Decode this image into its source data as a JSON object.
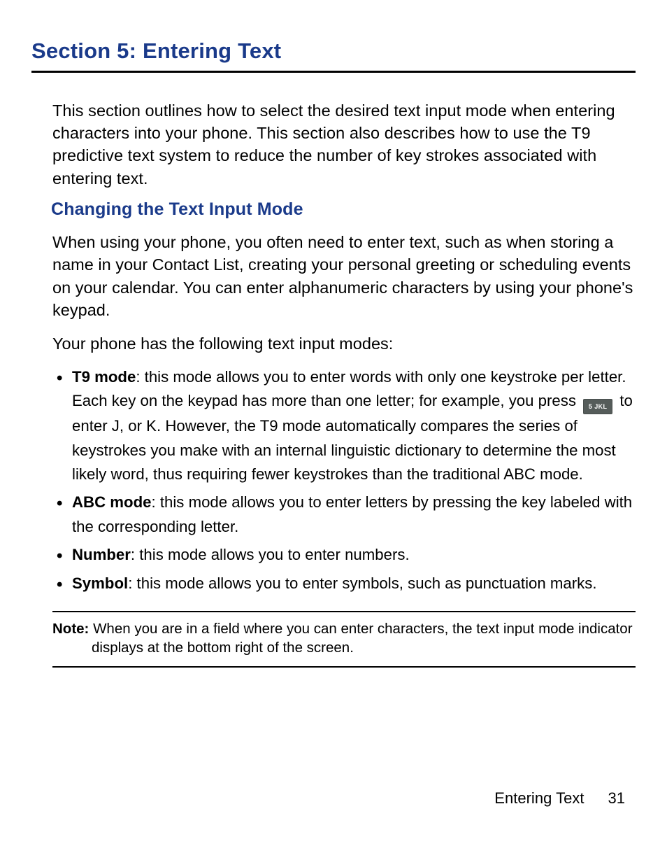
{
  "section_title": "Section 5: Entering Text",
  "intro": "This section outlines how to select the desired text input mode when entering characters into your phone. This section also describes how to use the T9 predictive text system to reduce the number of key strokes associated with entering text.",
  "sub_heading": "Changing the Text Input Mode",
  "body_p1": "When using your phone, you often need to enter text, such as when storing a name in your Contact List, creating your personal greeting or scheduling events on your calendar. You can enter alphanumeric characters by using your phone's keypad.",
  "body_p2": "Your phone has the following text input modes:",
  "modes": {
    "t9": {
      "bold": "T9 mode",
      "pre": ": this mode allows you to enter words with only one keystroke per letter. Each key on the keypad has more than one letter; for example, you press ",
      "key_label": "5 JKL",
      "post": " to enter J, or K. However, the T9 mode automatically compares the series of keystrokes you make with an internal linguistic dictionary to determine the most likely word, thus requiring fewer keystrokes than the traditional ABC mode."
    },
    "abc": {
      "bold": "ABC mode",
      "rest": ": this mode allows you to enter letters by pressing the key labeled with the corresponding letter."
    },
    "number": {
      "bold": "Number",
      "rest": ": this mode allows you to enter numbers."
    },
    "symbol": {
      "bold": "Symbol",
      "rest": ": this mode allows you to enter symbols, such as punctuation marks."
    }
  },
  "note": {
    "label": "Note:",
    "text": " When you are in a field where you can enter characters, the text input mode indicator displays at the bottom right of the screen."
  },
  "footer": {
    "section_name": "Entering Text",
    "page_number": "31"
  }
}
